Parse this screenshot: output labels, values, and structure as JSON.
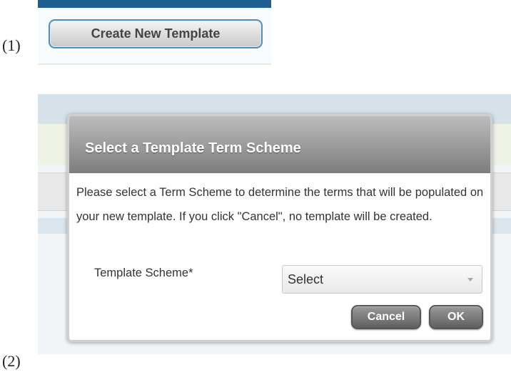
{
  "steps": {
    "first": "(1)",
    "second": "(2)"
  },
  "panel1": {
    "create_button_label": "Create New Template"
  },
  "dialog": {
    "title": "Select a Template Term Scheme",
    "message": "Please select a Term Scheme to determine the terms that will be populated on your new template. If you click \"Cancel\", no template will be created.",
    "scheme_label": "Template Scheme*",
    "scheme_selected": "Select",
    "cancel_label": "Cancel",
    "ok_label": "OK"
  },
  "colors": {
    "top_bar": "#1d5f8f",
    "button_border": "#4d8fbf",
    "dialog_header": "#8a8a8a"
  },
  "icons": {
    "dropdown": "chevron-down-icon"
  }
}
